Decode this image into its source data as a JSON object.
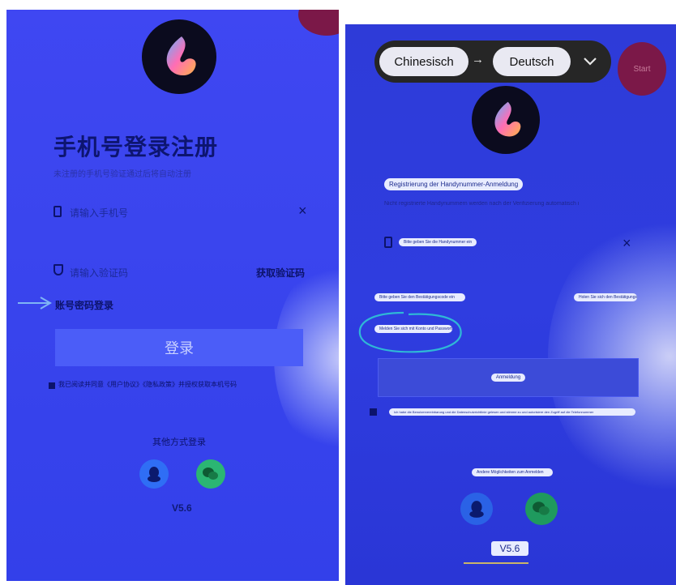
{
  "left": {
    "title": "手机号登录注册",
    "subtitle": "未注册的手机号验证通过后将自动注册",
    "phone_placeholder": "请输入手机号",
    "clear_icon": "×",
    "code_placeholder": "请输入验证码",
    "get_code": "获取验证码",
    "password_login": "账号密码登录",
    "login_button": "登录",
    "agreement": "我已阅读并同意《用户协议》《隐私政策》并授权获取本机号码",
    "other_methods": "其他方式登录",
    "version": "V5.6"
  },
  "right": {
    "translate_bar": {
      "source_lang": "Chinesisch",
      "arrow": "→",
      "target_lang": "Deutsch",
      "dropdown_icon": "chevron-down",
      "start_label": "Start"
    },
    "title": "Registrierung der Handynummer-Anmeldung",
    "subtitle": "Nicht registrierte Handynummern werden nach der Verifizierung automatisch registriert",
    "phone_placeholder": "Bitte geben Sie die Handynummer ein",
    "clear_icon": "×",
    "code_placeholder": "Bitte geben Sie den Bestätigungscode ein",
    "get_code": "Holen Sie sich den Bestätigungscode",
    "password_login": "Melden Sie sich mit Konto und Passwort an",
    "login_button": "Anmeldung",
    "agreement": "Ich habe die Benutzervereinbarung und die Datenschutzrichtlinie gelesen und stimme zu und autorisiere den Zugriff auf die Telefonnummer",
    "other_methods": "Andere Möglichkeiten zum Anmelden",
    "version": "V5.6"
  },
  "colors": {
    "left_bg": "#3f47f2",
    "right_bg": "#2e3bd8",
    "annotation_circle": "#2fb8d6",
    "annotation_arrow": "#7fb5f5",
    "version_underline": "#c9b46a",
    "qq": "#2f6ef5",
    "wechat": "#2bb673"
  }
}
